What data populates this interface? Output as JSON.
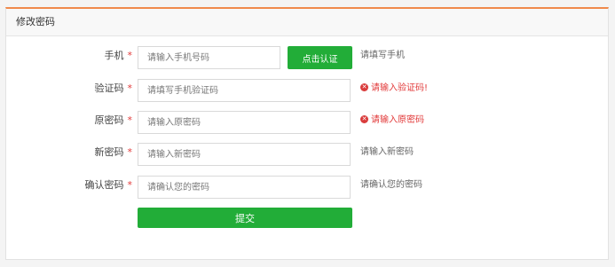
{
  "panel": {
    "title": "修改密码"
  },
  "form": {
    "required_mark": "*",
    "phone": {
      "label": "手机",
      "placeholder": "请输入手机号码",
      "button_label": "点击认证",
      "hint": "请填写手机"
    },
    "code": {
      "label": "验证码",
      "placeholder": "请填写手机验证码",
      "error": "请输入验证码!"
    },
    "old_password": {
      "label": "原密码",
      "placeholder": "请输入原密码",
      "error": "请输入原密码"
    },
    "new_password": {
      "label": "新密码",
      "placeholder": "请输入新密码",
      "hint": "请输入新密码"
    },
    "confirm_password": {
      "label": "确认密码",
      "placeholder": "请确认您的密码",
      "hint": "请确认您的密码"
    },
    "submit_label": "提交"
  },
  "icons": {
    "error": "error-circle-icon",
    "error_glyph": "✕"
  },
  "colors": {
    "accent_green": "#22ad38",
    "error_red": "#e23a3a",
    "header_accent": "#f08a4b"
  }
}
